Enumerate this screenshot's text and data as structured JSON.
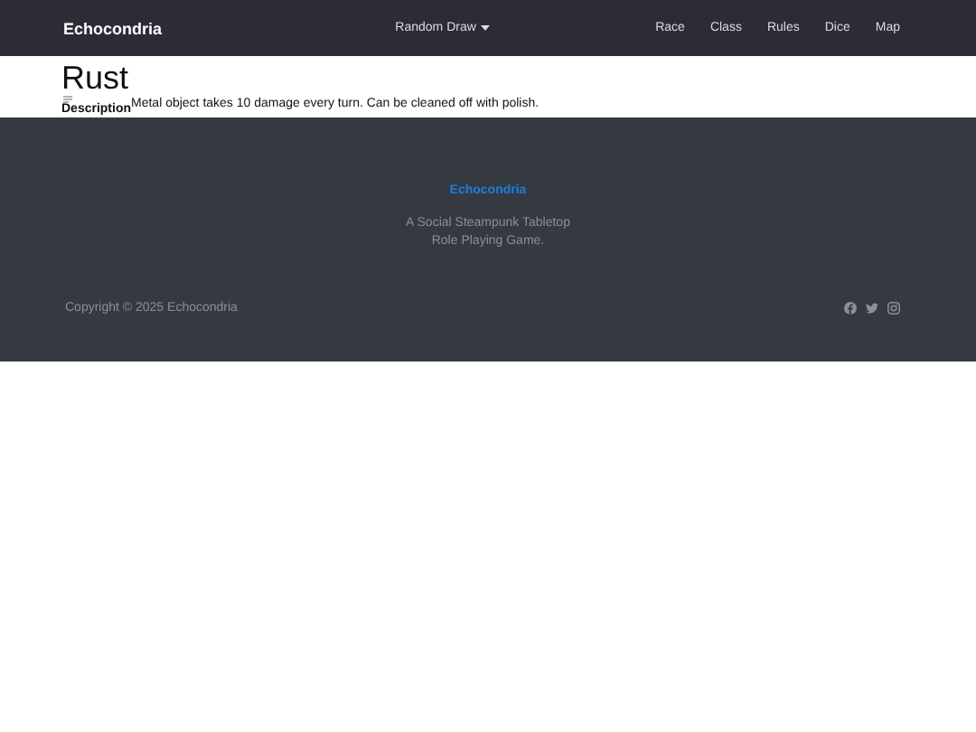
{
  "navbar": {
    "brand": "Echocondria",
    "dropdown": "Random Draw",
    "links": [
      "Race",
      "Class",
      "Rules",
      "Dice",
      "Map"
    ]
  },
  "item": {
    "title": "Rust",
    "field_label": "Description",
    "field_value": "Metal object takes 10 damage every turn. Can be cleaned off with polish."
  },
  "footer": {
    "brand": "Echocondria",
    "tagline": [
      "A Social Steampunk Tabletop",
      "Role Playing Game."
    ],
    "copyright": "Copyright © 2025 Echocondria"
  }
}
